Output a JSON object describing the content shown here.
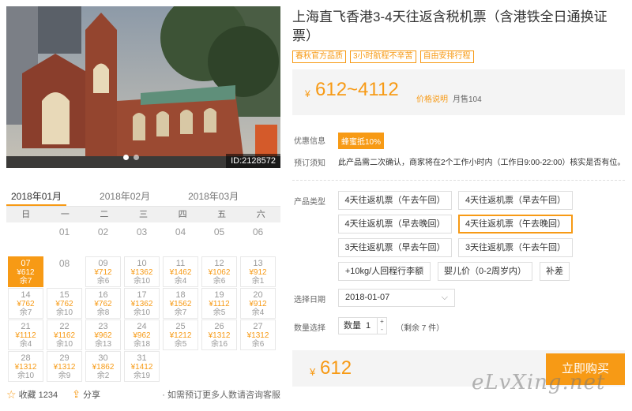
{
  "photo": {
    "id_label": "ID:2128572"
  },
  "calendar": {
    "months": [
      "2018年01月",
      "2018年02月",
      "2018年03月"
    ],
    "weekdays": [
      "日",
      "一",
      "二",
      "三",
      "四",
      "五",
      "六"
    ],
    "rows": [
      [
        null,
        {
          "day": "01"
        },
        {
          "day": "02"
        },
        {
          "day": "03"
        },
        {
          "day": "04"
        },
        {
          "day": "05"
        },
        {
          "day": "06"
        }
      ],
      [
        {
          "day": "07",
          "price": "¥612",
          "rem": "余7",
          "selected": true
        },
        {
          "day": "08"
        },
        {
          "day": "09",
          "price": "¥712",
          "rem": "余6"
        },
        {
          "day": "10",
          "price": "¥1362",
          "rem": "余10"
        },
        {
          "day": "11",
          "price": "¥1462",
          "rem": "余4"
        },
        {
          "day": "12",
          "price": "¥1062",
          "rem": "余6"
        },
        {
          "day": "13",
          "price": "¥912",
          "rem": "余1"
        }
      ],
      [
        {
          "day": "14",
          "price": "¥762",
          "rem": "余7"
        },
        {
          "day": "15",
          "price": "¥762",
          "rem": "余10"
        },
        {
          "day": "16",
          "price": "¥762",
          "rem": "余8"
        },
        {
          "day": "17",
          "price": "¥1362",
          "rem": "余10"
        },
        {
          "day": "18",
          "price": "¥1562",
          "rem": "余7"
        },
        {
          "day": "19",
          "price": "¥1112",
          "rem": "余5"
        },
        {
          "day": "20",
          "price": "¥912",
          "rem": "余4"
        }
      ],
      [
        {
          "day": "21",
          "price": "¥1112",
          "rem": "余4"
        },
        {
          "day": "22",
          "price": "¥1162",
          "rem": "余10"
        },
        {
          "day": "23",
          "price": "¥962",
          "rem": "余13"
        },
        {
          "day": "24",
          "price": "¥962",
          "rem": "余18"
        },
        {
          "day": "25",
          "price": "¥1212",
          "rem": "余5"
        },
        {
          "day": "26",
          "price": "¥1312",
          "rem": "余16"
        },
        {
          "day": "27",
          "price": "¥1312",
          "rem": "余6"
        }
      ],
      [
        {
          "day": "28",
          "price": "¥1312",
          "rem": "余10"
        },
        {
          "day": "29",
          "price": "¥1312",
          "rem": "余9"
        },
        {
          "day": "30",
          "price": "¥1862",
          "rem": "余2"
        },
        {
          "day": "31",
          "price": "¥1412",
          "rem": "余19"
        },
        null,
        null,
        null
      ]
    ]
  },
  "footer": {
    "favorite": "收藏 1234",
    "share": "分享",
    "tip": "· 如需预订更多人数请咨询客服"
  },
  "product": {
    "title": "上海直飞香港3-4天往返含税机票（含港铁全日通换证票）",
    "tags": [
      "春秋官方品质",
      "3小时航程不辛苦",
      "自由安排行程"
    ],
    "price_yen": "¥",
    "price_range": "612~4112",
    "price_explain": "价格说明",
    "sold": "月售104",
    "promo_label": "优惠信息",
    "promo_badge": "蜂蜜抵10%",
    "notice_label": "预订须知",
    "notice_text": "此产品需二次确认，商家将在2个工作小时内（工作日9:00-22:00）核实是否有位。",
    "type_label": "产品类型",
    "options": [
      "4天往返机票（午去午回）",
      "4天往返机票（早去午回）",
      "4天往返机票（早去晚回）",
      "4天往返机票（午去晚回）",
      "3天往返机票（早去午回）",
      "3天往返机票（午去午回）",
      "+10kg/人回程行李额",
      "婴儿价（0-2周岁内）",
      "补差"
    ],
    "date_label": "选择日期",
    "date_value": "2018-01-07",
    "qty_label": "数量选择",
    "qty_prefix": "数量",
    "qty_value": "1",
    "stock": "（剩余 7 件）",
    "total_yen": "¥",
    "total": "612",
    "buy_label": "立即购买"
  },
  "watermark": "eLvXing.net",
  "colors": {
    "accent": "#f79a15"
  }
}
